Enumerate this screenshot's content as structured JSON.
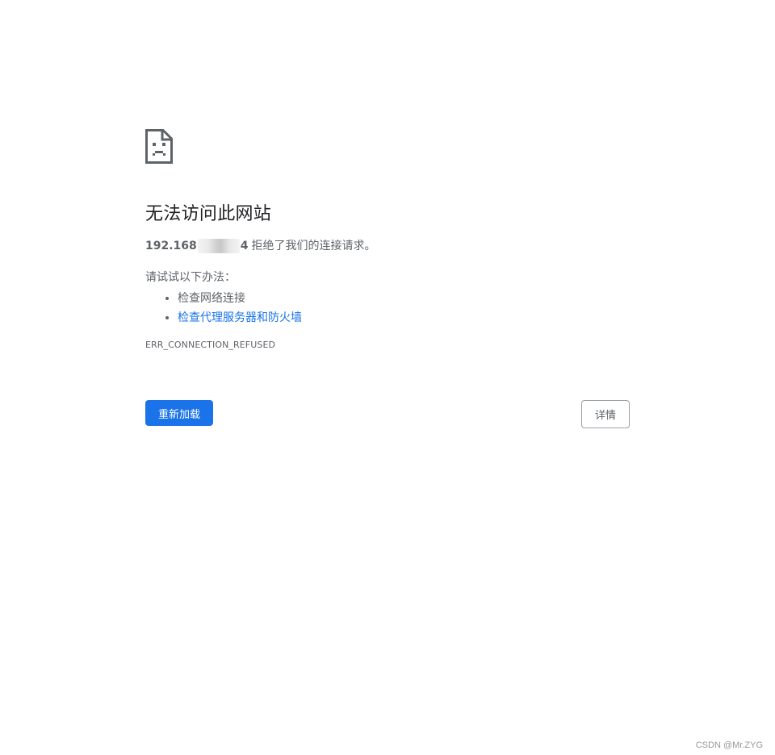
{
  "error_page": {
    "icon": "sad-document-icon",
    "title": "无法访问此网站",
    "host_prefix": "192.168",
    "host_suffix": "4",
    "message": "拒绝了我们的连接请求。",
    "suggestions_heading": "请试试以下办法：",
    "suggestions": [
      {
        "label": "检查网络连接",
        "is_link": false
      },
      {
        "label": "检查代理服务器和防火墙",
        "is_link": true
      }
    ],
    "error_code": "ERR_CONNECTION_REFUSED"
  },
  "buttons": {
    "reload_label": "重新加载",
    "details_label": "详情"
  },
  "watermark": "CSDN @Mr.ZYG",
  "colors": {
    "primary": "#1a73e8",
    "text": "#5f6368",
    "title": "#202124"
  }
}
